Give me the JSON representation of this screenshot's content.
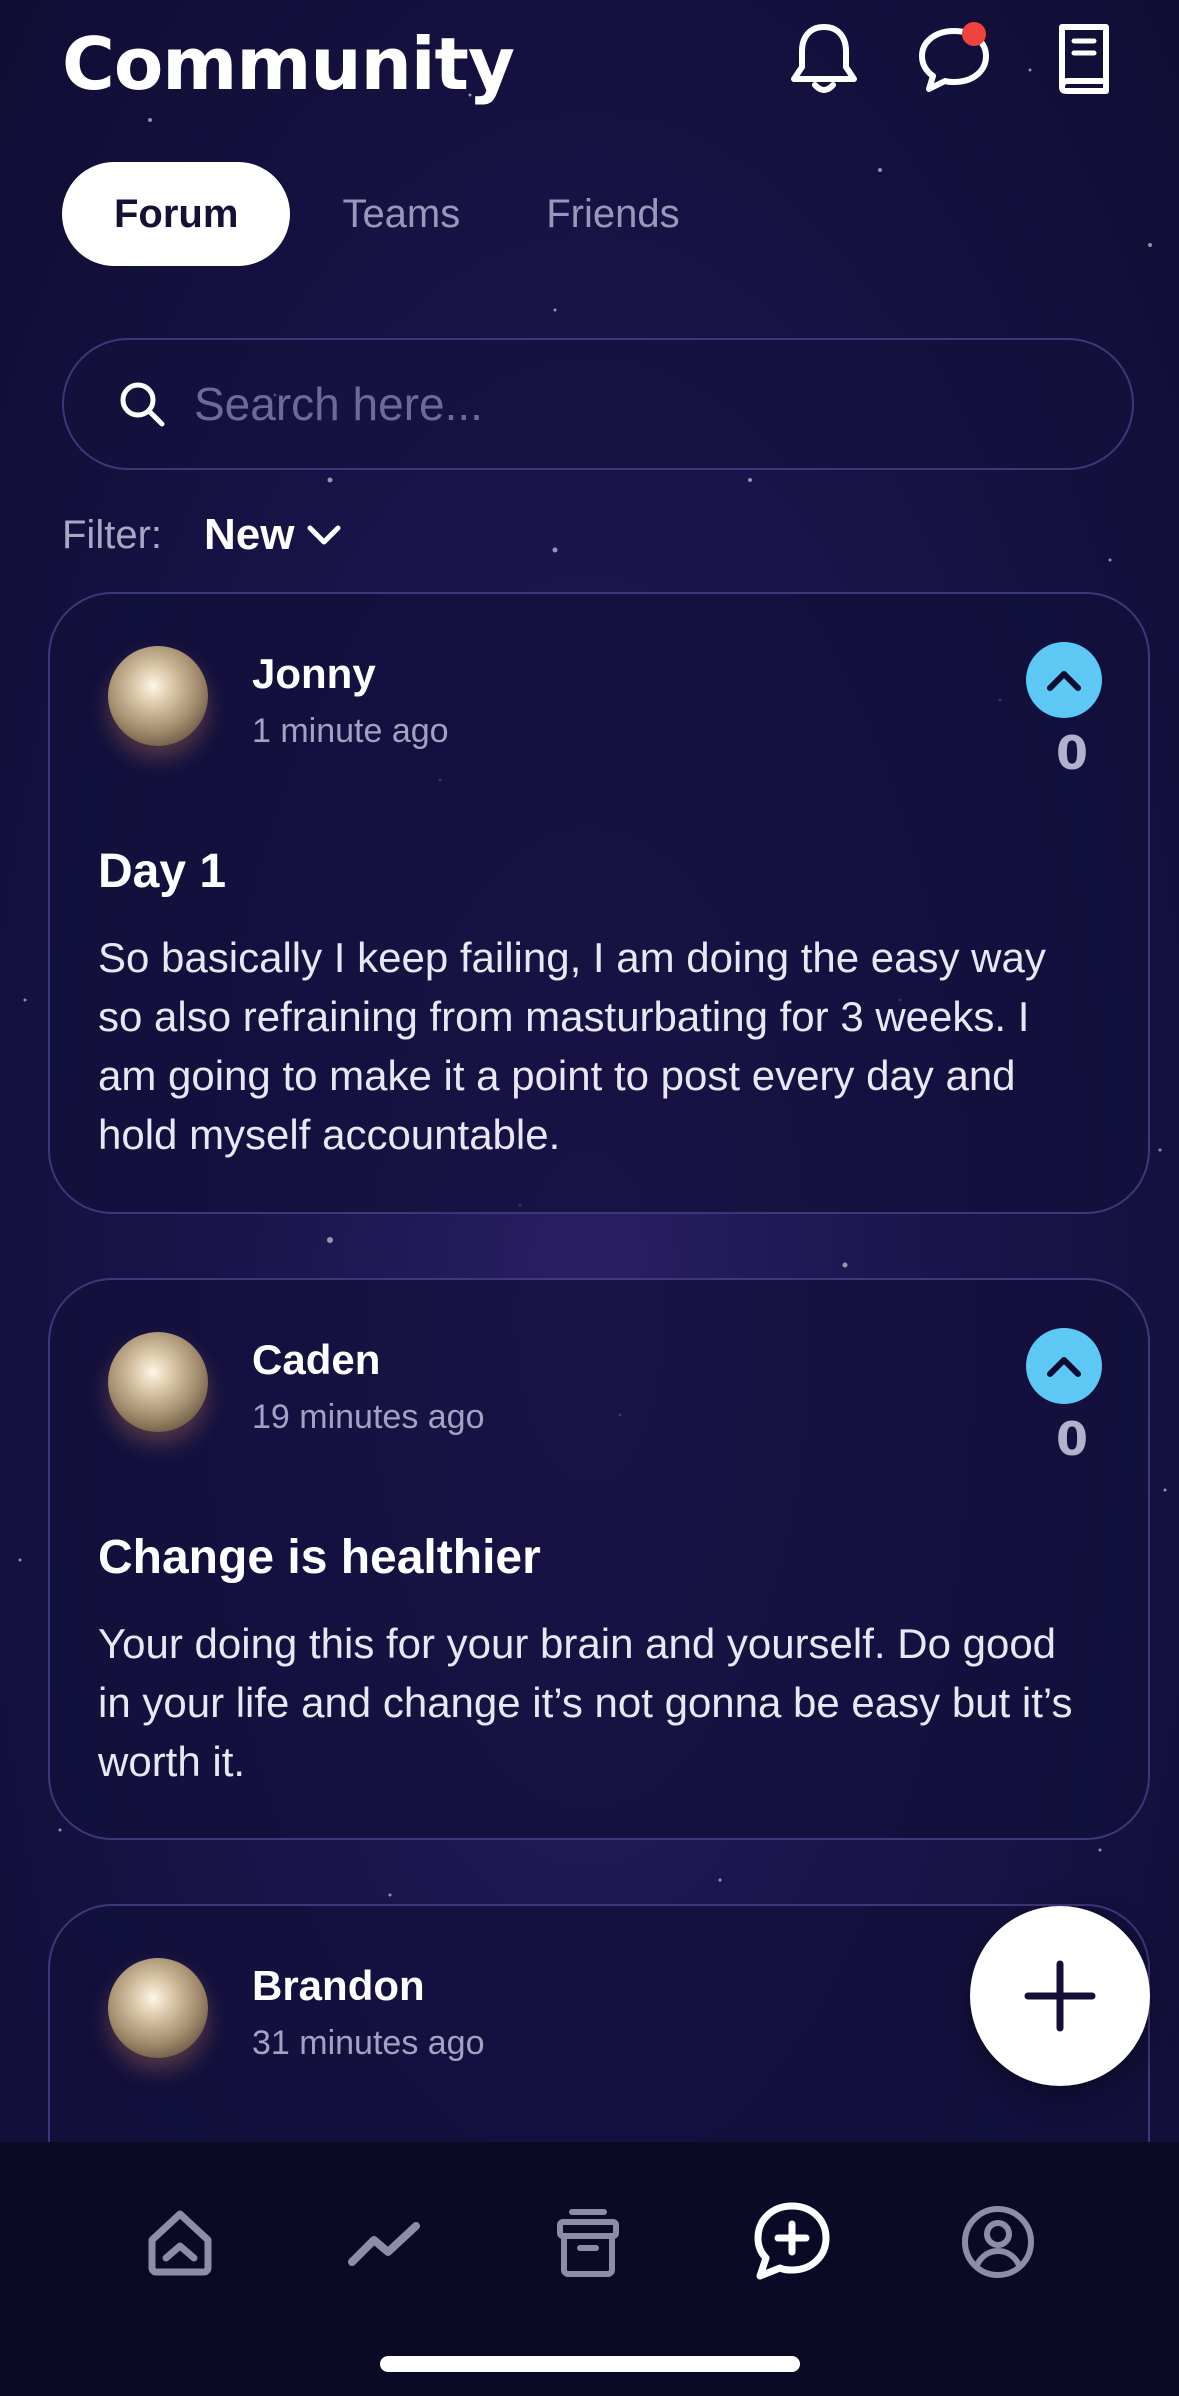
{
  "header": {
    "title": "Community",
    "icons": [
      "bell-icon",
      "chat-bubble-icon",
      "book-icon"
    ],
    "notification_dot_color": "#f0433c"
  },
  "tabs": [
    {
      "label": "Forum",
      "active": true
    },
    {
      "label": "Teams",
      "active": false
    },
    {
      "label": "Friends",
      "active": false
    }
  ],
  "search": {
    "placeholder": "Search here..."
  },
  "filter": {
    "label": "Filter:",
    "value": "New"
  },
  "posts": [
    {
      "author": "Jonny",
      "time": "1 minute ago",
      "votes": "0",
      "title": "Day 1",
      "body": "So basically I keep failing, I am doing the easy way so also refraining from masturbating for 3 weeks. I am going to make it a point to post every day and hold myself accountable."
    },
    {
      "author": "Caden",
      "time": "19 minutes ago",
      "votes": "0",
      "title": "Change is healthier",
      "body": "Your doing this for your brain and yourself. Do good in your life and change it’s not gonna be easy but it’s worth it."
    },
    {
      "author": "Brandon",
      "time": "31 minutes ago"
    }
  ],
  "bottom_nav": [
    "home-icon",
    "stats-icon",
    "archive-icon",
    "community-icon",
    "profile-icon"
  ],
  "colors": {
    "accent_vote": "#5ec8f5",
    "background": "#1c1650",
    "card_border": "#3d3878"
  }
}
